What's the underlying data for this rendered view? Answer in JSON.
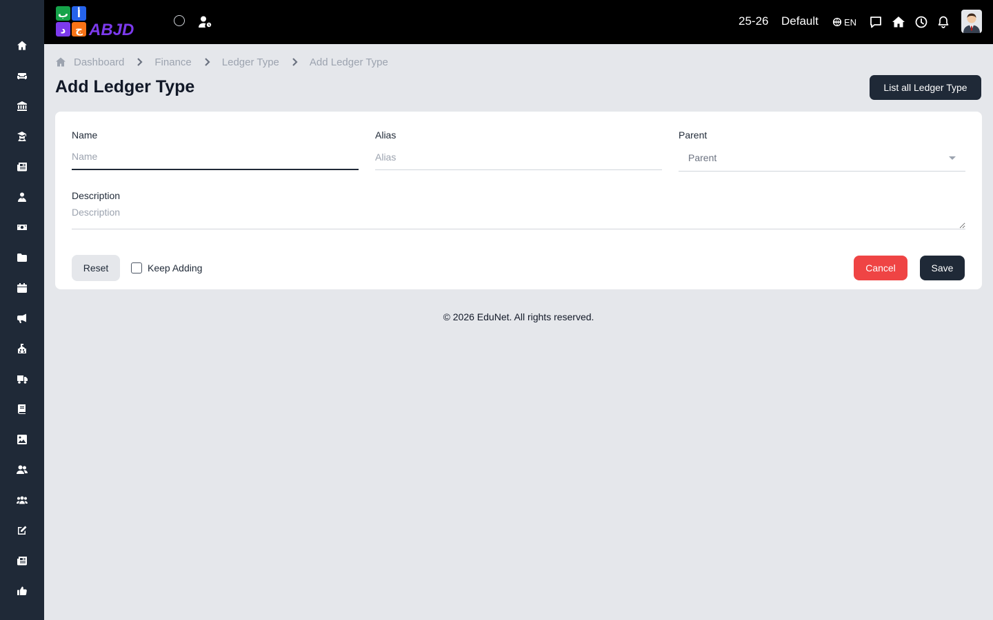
{
  "sidebar": {
    "items": [
      {
        "icon": "home-icon"
      },
      {
        "icon": "sofa-icon"
      },
      {
        "icon": "bank-icon"
      },
      {
        "icon": "graduate-icon"
      },
      {
        "icon": "newspaper-icon"
      },
      {
        "icon": "teacher-icon"
      },
      {
        "icon": "money-icon"
      },
      {
        "icon": "folder-icon"
      },
      {
        "icon": "calendar-icon"
      },
      {
        "icon": "megaphone-icon"
      },
      {
        "icon": "school-icon"
      },
      {
        "icon": "truck-icon"
      },
      {
        "icon": "book-icon"
      },
      {
        "icon": "image-icon"
      },
      {
        "icon": "users-icon"
      },
      {
        "icon": "group-icon"
      },
      {
        "icon": "edit-icon"
      },
      {
        "icon": "news-icon"
      },
      {
        "icon": "thumbs-up-icon"
      }
    ]
  },
  "topbar": {
    "logo_text": "ABJD",
    "logo_letters": [
      "ب",
      "أ",
      "د",
      "ج"
    ],
    "session": "25-26",
    "profile": "Default",
    "language": "EN"
  },
  "breadcrumb": {
    "items": [
      "Dashboard",
      "Finance",
      "Ledger Type",
      "Add Ledger Type"
    ]
  },
  "page": {
    "title": "Add Ledger Type",
    "list_button": "List all Ledger Type"
  },
  "form": {
    "name": {
      "label": "Name",
      "placeholder": "Name",
      "value": ""
    },
    "alias": {
      "label": "Alias",
      "placeholder": "Alias",
      "value": ""
    },
    "parent": {
      "label": "Parent",
      "selected": "Parent"
    },
    "description": {
      "label": "Description",
      "placeholder": "Description",
      "value": ""
    },
    "reset_label": "Reset",
    "keep_adding_label": "Keep Adding",
    "keep_adding_checked": false,
    "cancel_label": "Cancel",
    "save_label": "Save"
  },
  "footer": {
    "text": "© 2026 EduNet. All rights reserved."
  },
  "colors": {
    "sidebar_bg": "#1f2937",
    "topbar_bg": "#000000",
    "page_bg": "#e5e7eb",
    "primary": "#1f2937",
    "danger": "#ef4444",
    "logo_green": "#16a34a",
    "logo_blue": "#2563eb",
    "logo_purple": "#7c3aed",
    "logo_orange": "#f97316"
  }
}
